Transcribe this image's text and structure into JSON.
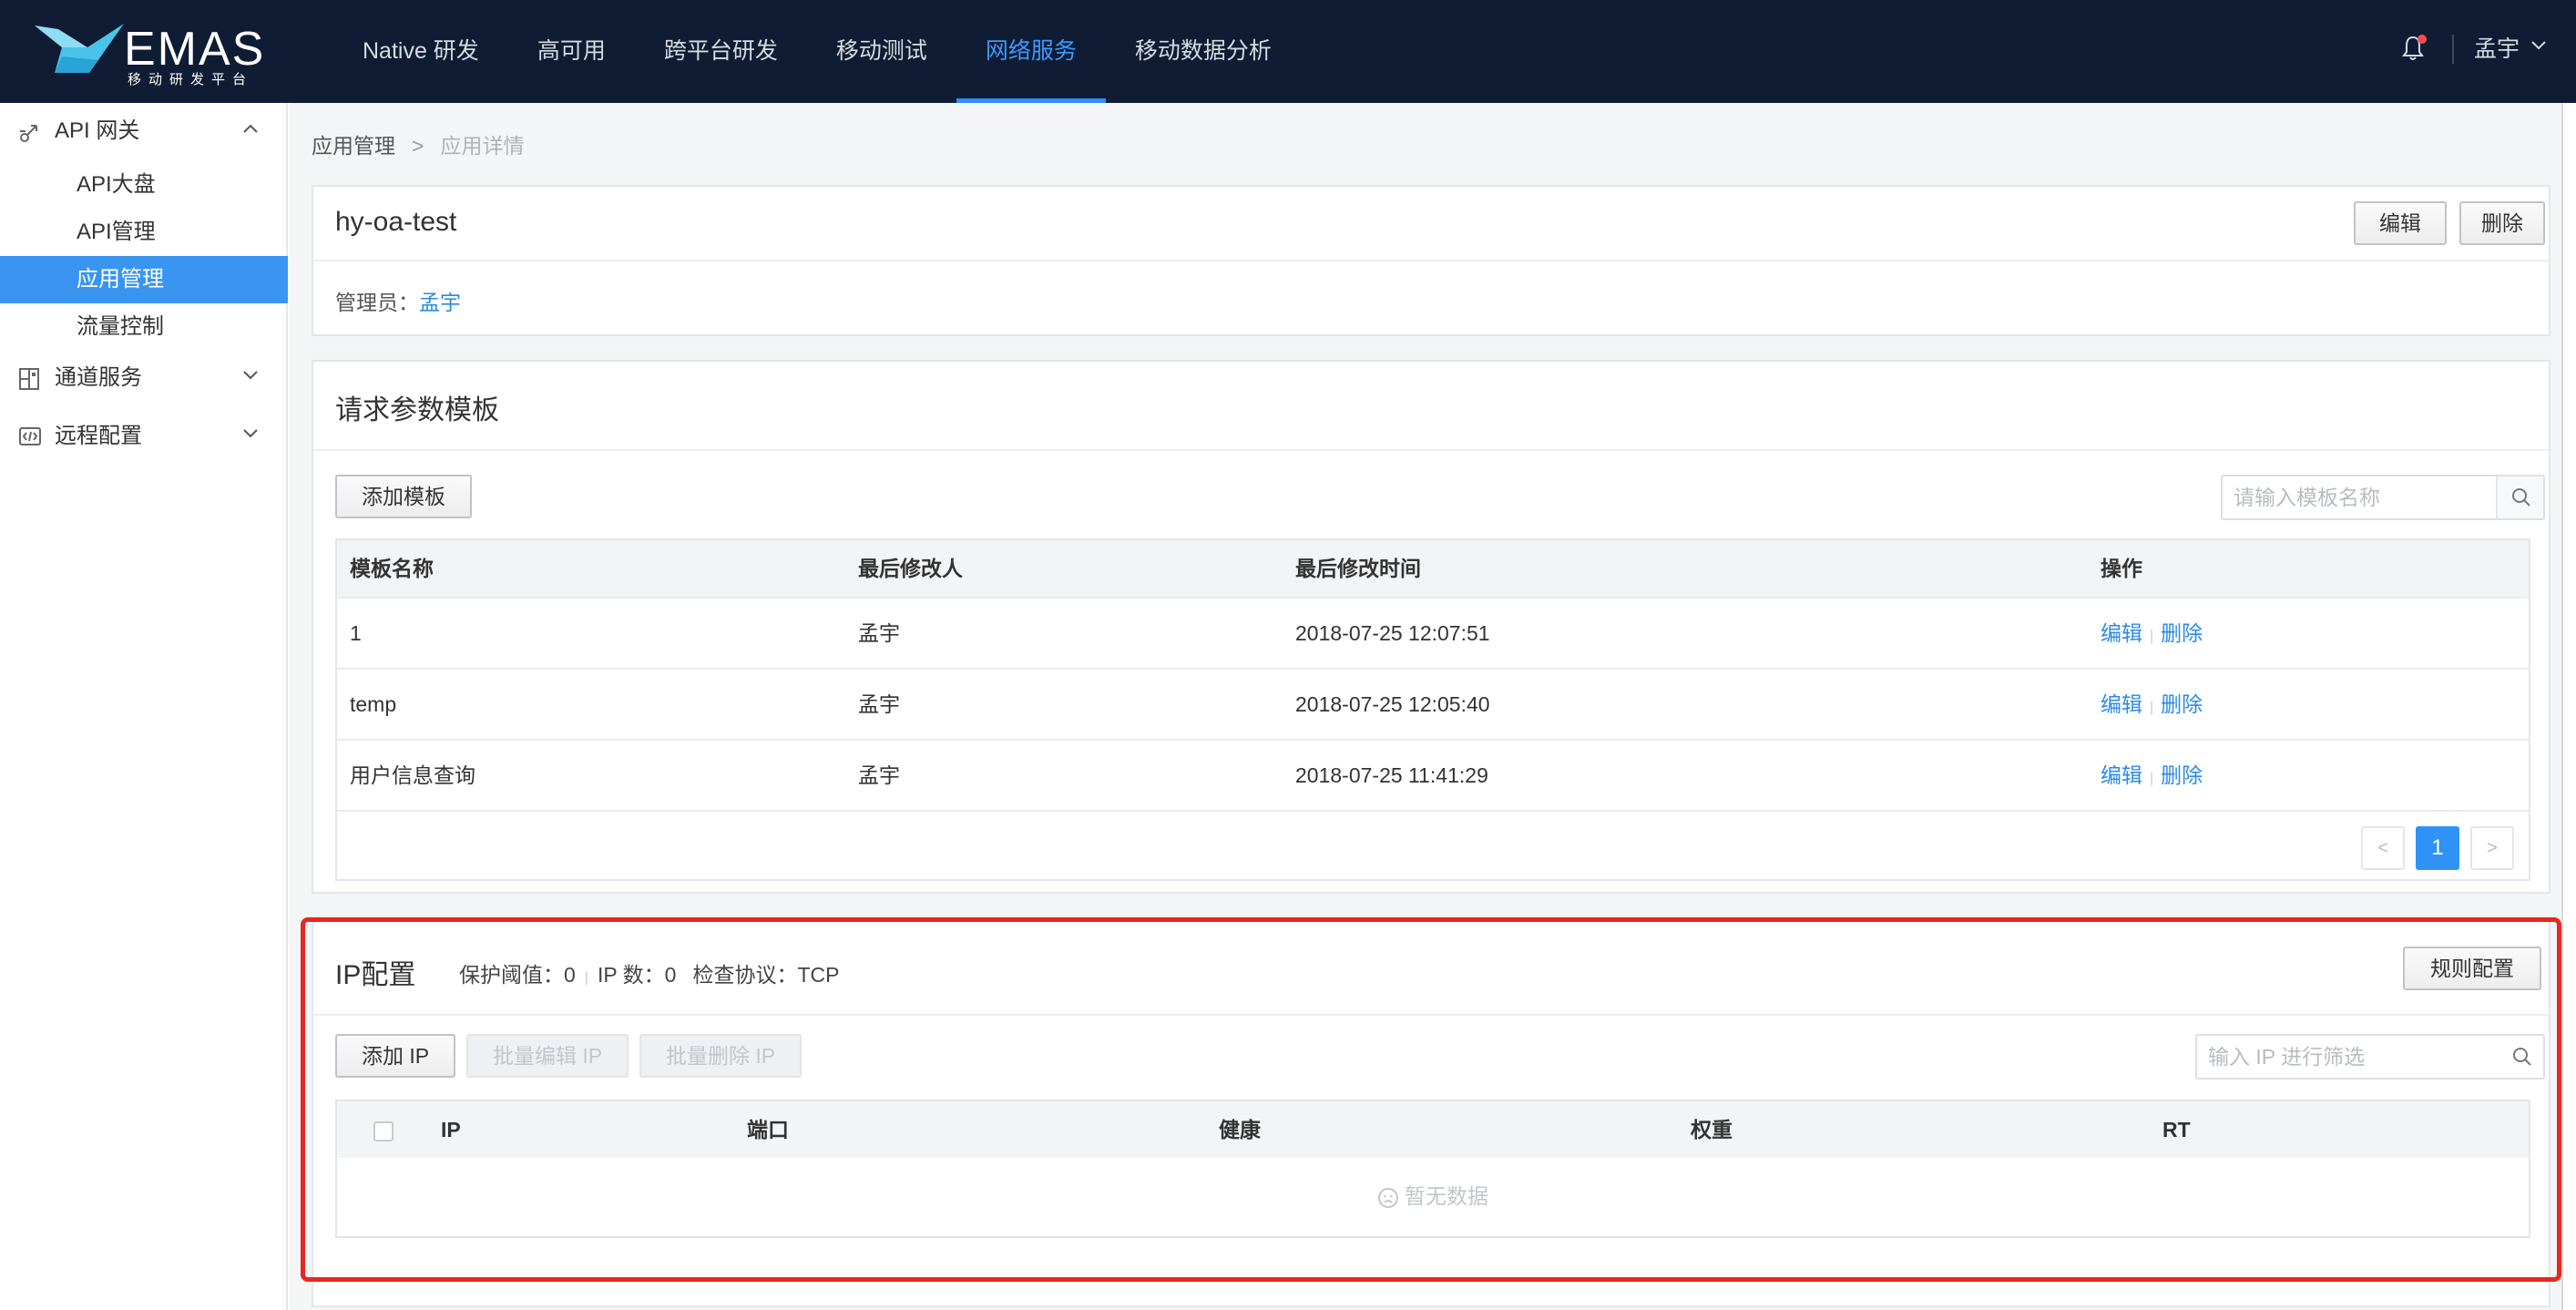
{
  "brand": {
    "name": "EMAS",
    "subtitle": "移动研发平台"
  },
  "nav": {
    "items": [
      "Native 研发",
      "高可用",
      "跨平台研发",
      "移动测试",
      "网络服务",
      "移动数据分析"
    ],
    "active_index": 4,
    "user": "孟宇"
  },
  "sidebar": {
    "groups": [
      {
        "label": "API 网关",
        "icon": "gateway-icon",
        "expanded": true
      },
      {
        "label": "通道服务",
        "icon": "channel-icon",
        "expanded": false
      },
      {
        "label": "远程配置",
        "icon": "remote-config-icon",
        "expanded": false
      }
    ],
    "items": [
      "API大盘",
      "API管理",
      "应用管理",
      "流量控制"
    ],
    "active_item": "应用管理"
  },
  "breadcrumb": {
    "parent": "应用管理",
    "separator": ">",
    "current": "应用详情"
  },
  "app": {
    "name": "hy-oa-test",
    "edit_label": "编辑",
    "delete_label": "删除",
    "admin_label": "管理员：",
    "admin_name": "孟宇"
  },
  "templates": {
    "title": "请求参数模板",
    "add_button": "添加模板",
    "search_placeholder": "请输入模板名称",
    "columns": [
      "模板名称",
      "最后修改人",
      "最后修改时间",
      "操作"
    ],
    "rows": [
      {
        "name": "1",
        "modifier": "孟宇",
        "time": "2018-07-25 12:07:51",
        "edit": "编辑",
        "delete": "删除"
      },
      {
        "name": "temp",
        "modifier": "孟宇",
        "time": "2018-07-25 12:05:40",
        "edit": "编辑",
        "delete": "删除"
      },
      {
        "name": "用户信息查询",
        "modifier": "孟宇",
        "time": "2018-07-25 11:41:29",
        "edit": "编辑",
        "delete": "删除"
      }
    ],
    "pagination": {
      "prev": "<",
      "page": "1",
      "next": ">"
    }
  },
  "ip_config": {
    "title": "IP配置",
    "protect_label": "保护阈值：",
    "protect_value": "0",
    "ip_count_label": "IP 数：",
    "ip_count_value": "0",
    "protocol_label": "检查协议：",
    "protocol_value": "TCP",
    "rule_button": "规则配置",
    "add_button": "添加 IP",
    "batch_edit_button": "批量编辑 IP",
    "batch_delete_button": "批量删除 IP",
    "filter_placeholder": "输入 IP 进行筛选",
    "columns": [
      "IP",
      "端口",
      "健康",
      "权重",
      "RT"
    ],
    "empty_text": "暂无数据"
  },
  "colors": {
    "topbar": "#0f1c33",
    "accent": "#3a95f0",
    "link": "#2b8ae8",
    "highlight": "#e8271f"
  }
}
